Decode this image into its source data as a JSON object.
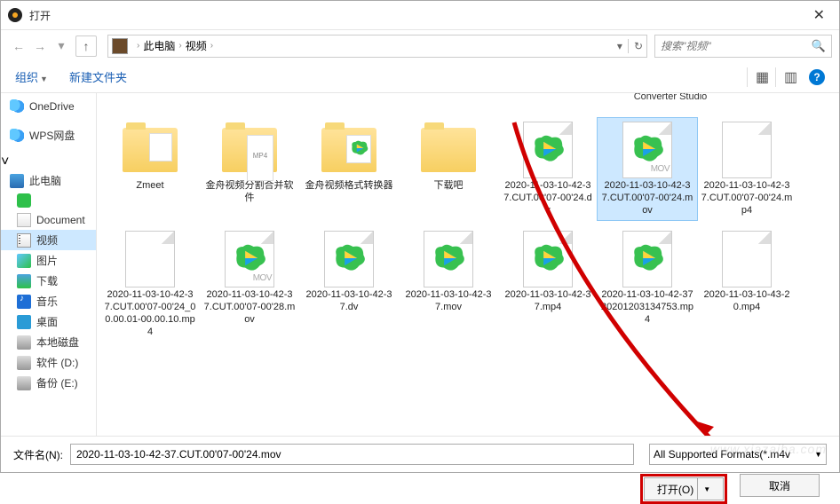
{
  "window": {
    "title": "打开",
    "close": "✕"
  },
  "nav": {
    "back": "←",
    "fwd": "→",
    "dropdown": "▾",
    "up": "↑",
    "crumbs": [
      "此电脑",
      "视频"
    ],
    "sep": "›",
    "addr_drop": "▾",
    "refresh": "↻",
    "search_placeholder": "搜索\"视频\"",
    "search_icon": "🔍"
  },
  "toolbar": {
    "organize": "组织",
    "newfolder": "新建文件夹",
    "view1": "▦",
    "view2": "▥",
    "help": "?"
  },
  "sidebar": {
    "items": [
      {
        "label": "OneDrive",
        "icon": "i-onedrive",
        "top": true
      },
      {
        "label": "WPS网盘",
        "icon": "i-wps",
        "top": true
      },
      {
        "label": "此电脑",
        "icon": "i-thispc",
        "top": true,
        "exp": true
      },
      {
        "label": "",
        "icon": "i-green"
      },
      {
        "label": "Document",
        "icon": "i-doc"
      },
      {
        "label": "视频",
        "icon": "i-video",
        "selected": true
      },
      {
        "label": "图片",
        "icon": "i-pic"
      },
      {
        "label": "下载",
        "icon": "i-down"
      },
      {
        "label": "音乐",
        "icon": "i-music"
      },
      {
        "label": "桌面",
        "icon": "i-desktop"
      },
      {
        "label": "本地磁盘",
        "icon": "i-hdd"
      },
      {
        "label": "软件 (D:)",
        "icon": "i-hdd"
      },
      {
        "label": "备份 (E:)",
        "icon": "i-hdd"
      }
    ]
  },
  "top_partial_label": "Converter Studio",
  "files": [
    {
      "name": "Zmeet",
      "type": "folder-page"
    },
    {
      "name": "金舟视频分割合并软件",
      "type": "folder-mp4"
    },
    {
      "name": "金舟视频格式转换器",
      "type": "folder-v"
    },
    {
      "name": "下载吧",
      "type": "folder"
    },
    {
      "name": "2020-11-03-10-42-37.CUT.00'07-00'24.dv",
      "type": "video"
    },
    {
      "name": "2020-11-03-10-42-37.CUT.00'07-00'24.mov",
      "type": "video-mov",
      "selected": true
    },
    {
      "name": "2020-11-03-10-42-37.CUT.00'07-00'24.mp4",
      "type": "blank"
    },
    {
      "name": "2020-11-03-10-42-37.CUT.00'07-00'24_00.00.01-00.00.10.mp4",
      "type": "blank"
    },
    {
      "name": "2020-11-03-10-42-37.CUT.00'07-00'28.mov",
      "type": "video-mov"
    },
    {
      "name": "2020-11-03-10-42-37.dv",
      "type": "video"
    },
    {
      "name": "2020-11-03-10-42-37.mov",
      "type": "video"
    },
    {
      "name": "2020-11-03-10-42-37.mp4",
      "type": "video"
    },
    {
      "name": "2020-11-03-10-42-3720201203134753.mp4",
      "type": "video"
    },
    {
      "name": "2020-11-03-10-43-20.mp4",
      "type": "blank"
    }
  ],
  "bottom": {
    "filename_label": "文件名(N):",
    "filename_value": "2020-11-03-10-42-37.CUT.00'07-00'24.mov",
    "filter": "All Supported Formats(*.m4v",
    "open": "打开(O)",
    "cancel": "取消"
  },
  "watermark": "www.xiazaiba.com"
}
